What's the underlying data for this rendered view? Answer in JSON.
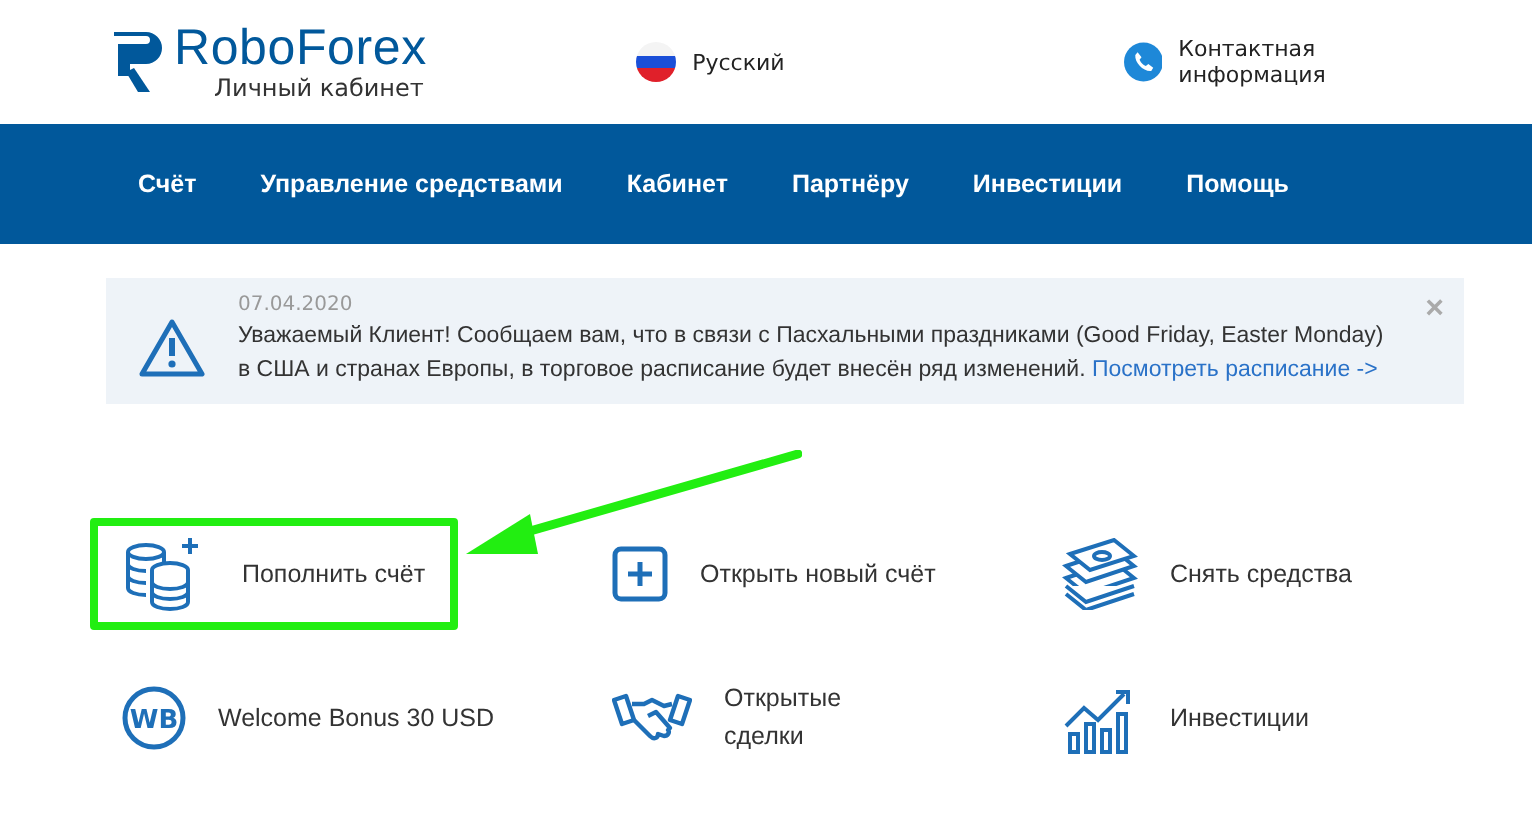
{
  "logo": {
    "name": "RoboForex",
    "subtitle": "Личный кабинет"
  },
  "language": {
    "label": "Русский"
  },
  "contact": {
    "label": "Контактная информация"
  },
  "nav": [
    {
      "label": "Счёт"
    },
    {
      "label": "Управление средствами"
    },
    {
      "label": "Кабинет"
    },
    {
      "label": "Партнёру"
    },
    {
      "label": "Инвестиции"
    },
    {
      "label": "Помощь"
    }
  ],
  "notice": {
    "date": "07.04.2020",
    "text": "Уважаемый Клиент! Сообщаем вам, что в связи с Пасхальными праздниками (Good Friday, Easter Monday) в США и странах Европы, в торговое расписание будет внесён ряд изменений.",
    "link": "Посмотреть расписание ->",
    "close": "×"
  },
  "actions": [
    {
      "kind": "deposit",
      "label": "Пополнить счёт",
      "highlighted": true
    },
    {
      "kind": "open",
      "label": "Открыть новый счёт",
      "highlighted": false
    },
    {
      "kind": "withdraw",
      "label": "Снять средства",
      "highlighted": false
    },
    {
      "kind": "bonus",
      "label": "Welcome Bonus 30 USD",
      "highlighted": false,
      "badge": "WB"
    },
    {
      "kind": "deals",
      "label": "Открытые сделки",
      "highlighted": false
    },
    {
      "kind": "invest",
      "label": "Инвестиции",
      "highlighted": false
    }
  ]
}
